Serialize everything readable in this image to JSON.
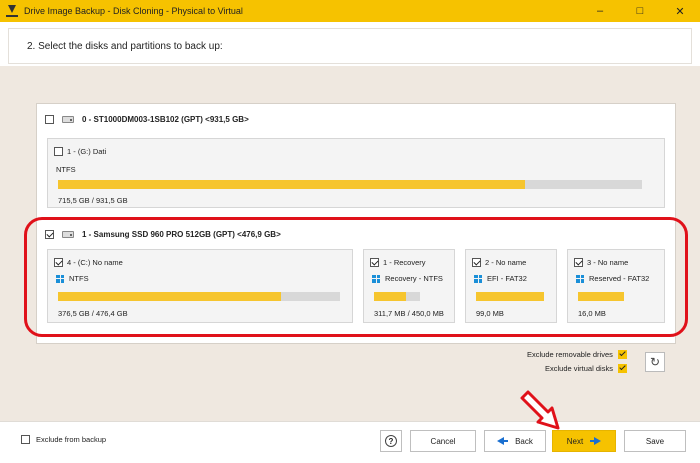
{
  "window": {
    "title": "Drive Image Backup - Disk Cloning - Physical to Virtual",
    "controls": [
      "–",
      "□",
      "✕"
    ]
  },
  "step": {
    "text": "2. Select the disks and partitions to back up:"
  },
  "disks": [
    {
      "label": "0 - ST1000DM003-1SB102 (GPT) <931,5 GB>",
      "checked": false,
      "partitions": [
        {
          "label": "1 - (G:) Dati",
          "fs": "NTFS",
          "size": "715,5 GB / 931,5 GB",
          "used_fraction": 0.8,
          "checked": false,
          "win_icon": false
        }
      ]
    },
    {
      "label": "1 - Samsung SSD 960 PRO 512GB (GPT) <476,9 GB>",
      "checked": true,
      "partitions": [
        {
          "label": "4 - (C:) No name",
          "fs": "NTFS",
          "size": "376,5 GB / 476,4 GB",
          "used_fraction": 0.79,
          "checked": true,
          "win_icon": true
        },
        {
          "label": "1 - Recovery",
          "fs": "Recovery - NTFS",
          "size": "311,7 MB / 450,0 MB",
          "used_fraction": 0.69,
          "checked": true,
          "win_icon": true
        },
        {
          "label": "2 - No name",
          "fs": "EFI - FAT32",
          "size": "99,0 MB",
          "used_fraction": 1.0,
          "checked": true,
          "win_icon": true
        },
        {
          "label": "3 - No name",
          "fs": "Reserved - FAT32",
          "size": "16,0 MB",
          "used_fraction": 1.0,
          "checked": true,
          "win_icon": true
        }
      ]
    }
  ],
  "options": {
    "exclude_removable": "Exclude removable drives",
    "exclude_virtual": "Exclude virtual disks"
  },
  "bottom": {
    "exclude_from_backup": "Exclude from backup",
    "help": "?",
    "cancel": "Cancel",
    "back": "Back",
    "next": "Next",
    "save": "Save"
  },
  "colors": {
    "accent": "#f6c200",
    "highlight": "#e0111a",
    "bar_fill": "#f6c52e"
  }
}
